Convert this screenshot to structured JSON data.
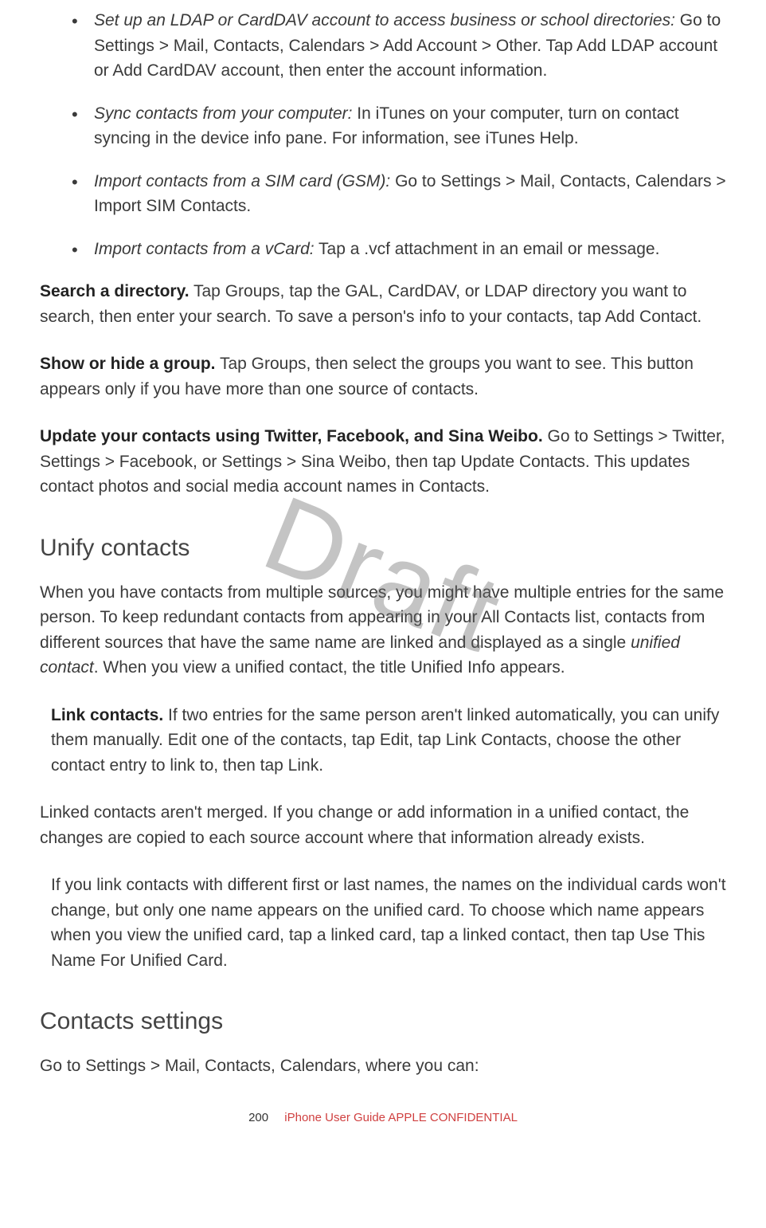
{
  "bullets": [
    {
      "lead": "Set up an LDAP or CardDAV account to access business or school directories:",
      "rest": " Go to Settings > Mail, Contacts, Calendars > Add Account > Other. Tap Add LDAP account or Add CardDAV account, then enter the account information."
    },
    {
      "lead": "Sync contacts from your computer:",
      "rest": " In iTunes on your computer, turn on contact syncing in the device info pane. For information, see iTunes Help."
    },
    {
      "lead": "Import contacts from a SIM card (GSM):",
      "rest": " Go to Settings > Mail, Contacts, Calendars > Import SIM Contacts."
    },
    {
      "lead": "Import contacts from a vCard:",
      "rest": " Tap a .vcf attachment in an email or message."
    }
  ],
  "paras": {
    "searchDirectory": {
      "bold": "Search a directory.",
      "rest": " Tap Groups, tap the GAL, CardDAV, or LDAP directory you want to search, then enter your search. To save a person's info to your contacts, tap Add Contact."
    },
    "showHideGroup": {
      "bold": "Show or hide a group.",
      "rest": " Tap Groups, then select the groups you want to see. This button appears only if you have more than one source of contacts."
    },
    "updateContacts": {
      "bold": "Update your contacts using Twitter, Facebook, and Sina Weibo.",
      "rest": " Go to Settings > Twitter, Settings > Facebook, or Settings > Sina Weibo, then tap Update Contacts. This updates contact photos and social media account names in Contacts."
    }
  },
  "unify": {
    "heading": "Unify contacts",
    "intro_pre": "When you have contacts from multiple sources, you might have multiple entries for the same person. To keep redundant contacts from appearing in your All Contacts list, contacts from different sources that have the same name are linked and displayed as a single ",
    "intro_italic": "unified contact",
    "intro_post": ". When you view a unified contact, the title Unified Info appears.",
    "linkContacts": {
      "bold": "Link contacts.",
      "rest": " If two entries for the same person aren't linked automatically, you can unify them manually. Edit one of the contacts, tap Edit, tap Link Contacts, choose the other contact entry to link to, then tap Link."
    },
    "notMerged": "Linked contacts aren't merged. If you change or add information in a unified contact, the changes are copied to each source account where that information already exists.",
    "diffNames": "If you link contacts with different first or last names, the names on the individual cards won't change, but only one name appears on the unified card. To choose which name appears when you view the unified card, tap a linked card, tap a linked contact, then tap Use This Name For Unified Card."
  },
  "settings": {
    "heading": "Contacts settings",
    "intro": "Go to Settings > Mail, Contacts, Calendars, where you can:"
  },
  "watermark": "Draft",
  "footer": {
    "page": "200",
    "guide": "iPhone User Guide",
    "confidential": "  APPLE CONFIDENTIAL"
  }
}
